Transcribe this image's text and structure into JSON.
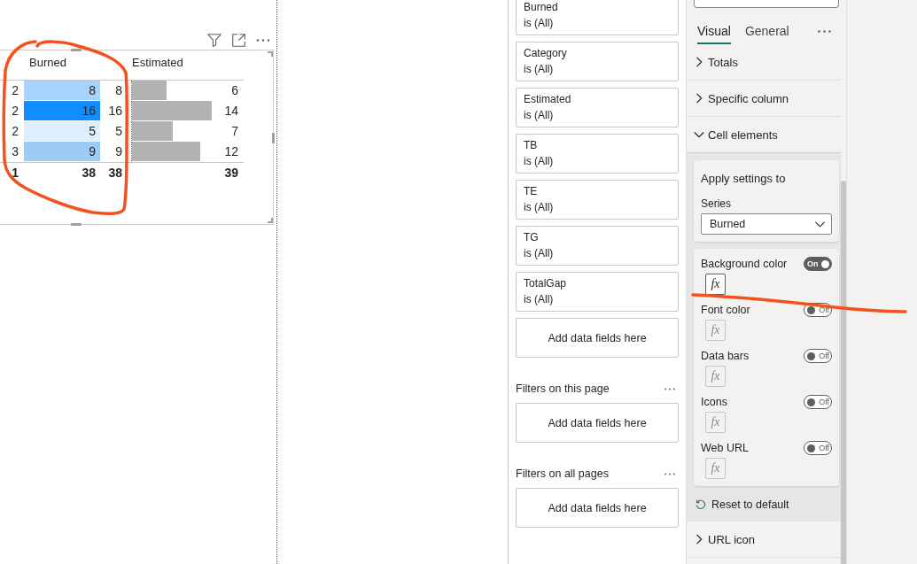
{
  "visual": {
    "table": {
      "headers": {
        "burned": "Burned",
        "estimated": "Estimated"
      },
      "rows": [
        {
          "column_1": "2",
          "burned": {
            "value": "8",
            "color": "#a6d2fb"
          },
          "column_3": "8",
          "estimated": {
            "value": "6",
            "level": 0.39
          }
        },
        {
          "column_1": "2",
          "burned": {
            "value": "16",
            "color": "#118dff"
          },
          "column_3": "16",
          "estimated": {
            "value": "14",
            "level": 0.91
          }
        },
        {
          "column_1": "2",
          "burned": {
            "value": "5",
            "color": "#ddeefd"
          },
          "column_3": "5",
          "estimated": {
            "value": "7",
            "level": 0.46
          }
        },
        {
          "column_1": "3",
          "burned": {
            "value": "9",
            "color": "#9ccbf8"
          },
          "column_3": "9",
          "estimated": {
            "value": "12",
            "level": 0.78
          }
        }
      ],
      "totals": {
        "column_1": "1",
        "burned": "38",
        "column_3": "38",
        "estimated": "39"
      }
    }
  },
  "filters_pane": {
    "visual_filters": [
      {
        "field": "Burned",
        "condition": "is (All)"
      },
      {
        "field": "Category",
        "condition": "is (All)"
      },
      {
        "field": "Estimated",
        "condition": "is (All)"
      },
      {
        "field": "TB",
        "condition": "is (All)"
      },
      {
        "field": "TE",
        "condition": "is (All)"
      },
      {
        "field": "TG",
        "condition": "is (All)"
      },
      {
        "field": "TotalGap",
        "condition": "is (All)"
      }
    ],
    "visual_drop_zone": "Add data fields here",
    "page_filters": {
      "title": "Filters on this page",
      "drop_zone": "Add data fields here"
    },
    "all_pages_filters": {
      "title": "Filters on all pages",
      "drop_zone": "Add data fields here"
    }
  },
  "format_pane": {
    "tabs": [
      {
        "label": "Visual",
        "selected": true
      },
      {
        "label": "General",
        "selected": false
      }
    ],
    "sections": [
      {
        "label": "Totals",
        "expanded": false
      },
      {
        "label": "Specific column",
        "expanded": false
      },
      {
        "label": "Cell elements",
        "expanded": true,
        "apply_settings": {
          "title": "Apply settings to",
          "series_label": "Series",
          "series_value": "Burned"
        },
        "elements": [
          {
            "label": "Background color",
            "on": true,
            "toggle_text": "On",
            "fx": "fx"
          },
          {
            "label": "Font color",
            "on": false,
            "toggle_text": "Off",
            "fx": "fx"
          },
          {
            "label": "Data bars",
            "on": false,
            "toggle_text": "Off",
            "fx": "fx"
          },
          {
            "label": "Icons",
            "on": false,
            "toggle_text": "Off",
            "fx": "fx"
          },
          {
            "label": "Web URL",
            "on": false,
            "toggle_text": "Off",
            "fx": "fx"
          }
        ],
        "reset": "Reset to default"
      },
      {
        "label": "URL icon",
        "expanded": false
      }
    ]
  }
}
